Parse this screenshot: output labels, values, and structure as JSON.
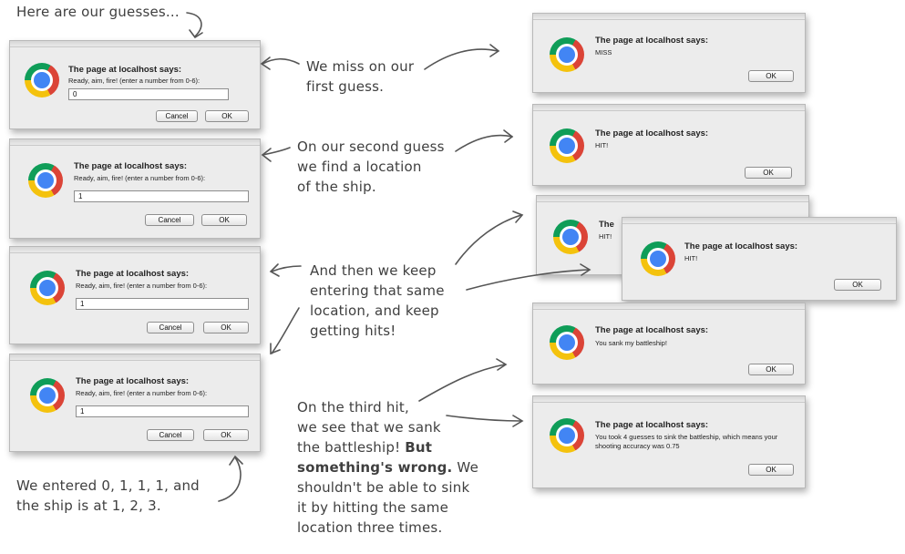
{
  "title_note": "Here are our guesses...",
  "prompt_title": "The page at localhost says:",
  "prompt_text": "Ready, aim, fire! (enter a number from 0-6):",
  "cancel_label": "Cancel",
  "ok_label": "OK",
  "prompts": [
    {
      "value": "0"
    },
    {
      "value": "1"
    },
    {
      "value": "1"
    },
    {
      "value": "1"
    }
  ],
  "alerts": [
    {
      "title": "The page at localhost says:",
      "message": "MISS"
    },
    {
      "title": "The page at localhost says:",
      "message": "HIT!"
    },
    {
      "title": "The page at localhost says:",
      "message": "HIT!"
    },
    {
      "title": "The page at localhost says:",
      "message": "HIT!"
    },
    {
      "title": "The page at localhost says:",
      "message": "You sank my battleship!"
    },
    {
      "title": "The page at localhost says:",
      "message": "You took 4 guesses to sink the battleship, which means your shooting accuracy was 0.75"
    }
  ],
  "alert3_partial_title": "The",
  "notes": {
    "miss": [
      "We miss on our",
      "first guess."
    ],
    "second": [
      "On our second guess",
      "we find a location",
      "of the ship."
    ],
    "keep": [
      "And then we keep",
      "entering that same",
      "location, and keep",
      "getting hits!"
    ],
    "entered": [
      "We entered 0, 1, 1, 1, and",
      "the ship is at 1, 2, 3."
    ],
    "third_plain": [
      "On the third hit,",
      "we see that we sank"
    ],
    "third_mixed_a": "the battleship! ",
    "third_mixed_b": "But",
    "third_bold": "something's wrong.",
    "third_tail_a": " We",
    "third_rest": [
      "shouldn't be able to sink",
      "it by hitting the same",
      "location three times."
    ]
  },
  "colors": {
    "dialog_bg": "#ececec",
    "note_ink": "#3f3f3f"
  }
}
